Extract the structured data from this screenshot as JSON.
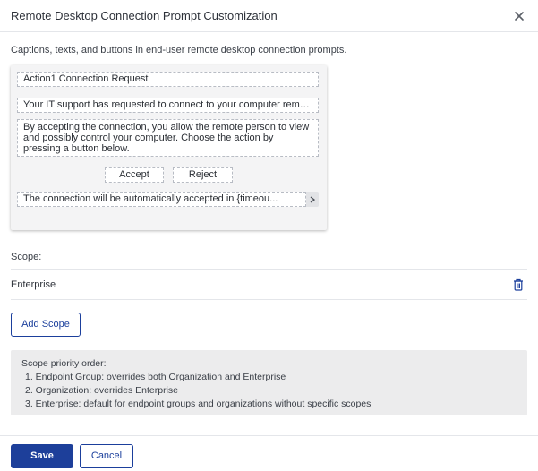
{
  "dialog": {
    "title": "Remote Desktop Connection Prompt Customization",
    "description": "Captions, texts, and buttons in end-user remote desktop connection prompts."
  },
  "preview": {
    "title": "Action1 Connection Request",
    "message": "Your IT support has requested to connect to your computer remotely.",
    "body": "By accepting the connection, you allow the remote person to view and possibly control your computer. Choose the action by pressing a button below.",
    "accept_label": "Accept",
    "reject_label": "Reject",
    "timer_text": "The connection will be automatically accepted in {timeou..."
  },
  "scope": {
    "label": "Scope:",
    "items": [
      {
        "name": "Enterprise"
      }
    ],
    "add_label": "Add Scope"
  },
  "info": {
    "heading": "Scope priority order:",
    "items": [
      "1. Endpoint Group: overrides both Organization and Enterprise",
      "2. Organization: overrides Enterprise",
      "3. Enterprise: default for endpoint groups and organizations without specific scopes"
    ]
  },
  "footer": {
    "save_label": "Save",
    "cancel_label": "Cancel"
  },
  "colors": {
    "primary": "#1d3f9a",
    "icon": "#1b3f9c"
  },
  "icons": {
    "close": "close-icon",
    "trash": "trash-icon",
    "chevron": "chevron-right-icon"
  }
}
